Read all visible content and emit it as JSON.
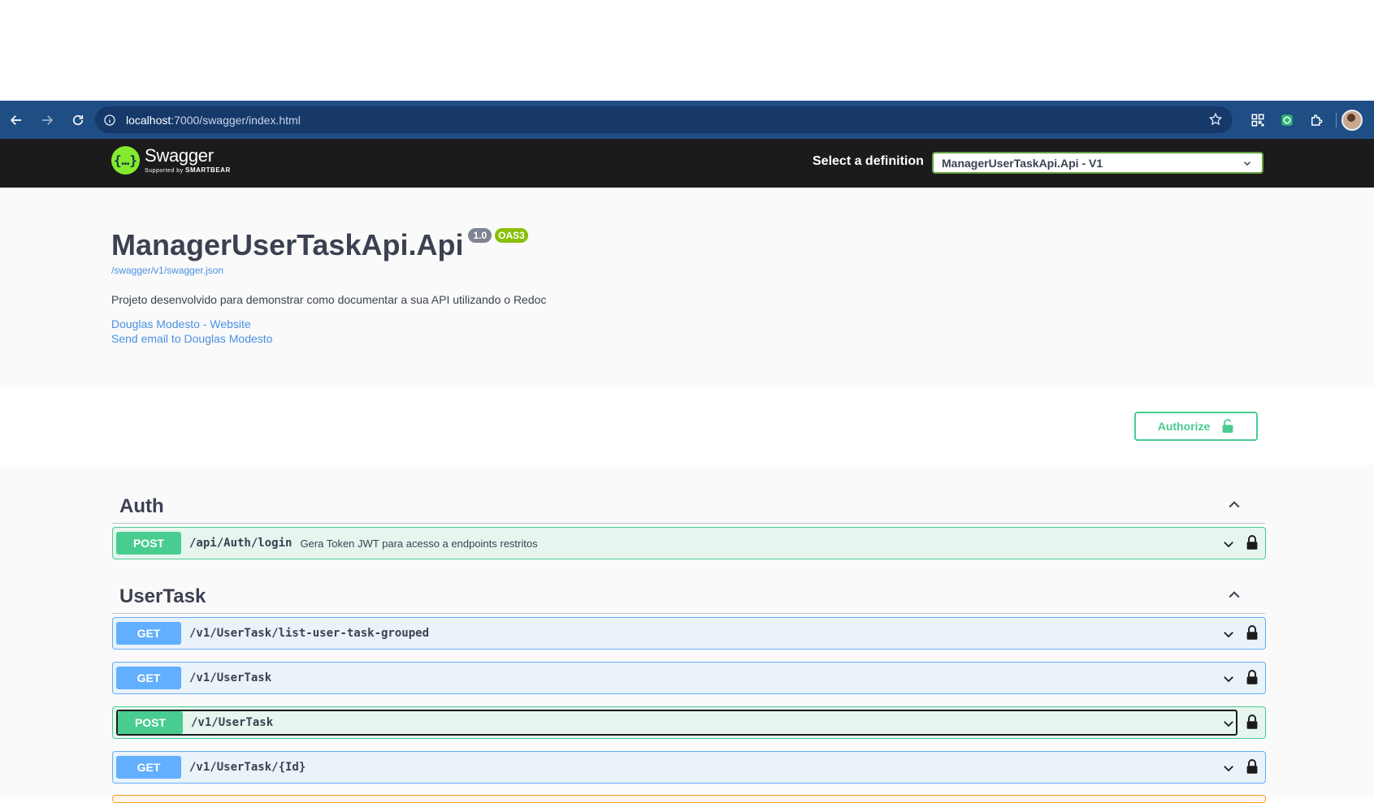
{
  "browser": {
    "url_host": "localhost",
    "url_path": ":7000/swagger/index.html"
  },
  "topbar": {
    "logo_title": "Swagger",
    "logo_supported": "Supported by",
    "logo_smartbear": "SMARTBEAR",
    "select_label": "Select a definition",
    "selected_definition": "ManagerUserTaskApi.Api - V1"
  },
  "info": {
    "title": "ManagerUserTaskApi.Api",
    "version": "1.0",
    "oas": "OAS3",
    "spec_url": "/swagger/v1/swagger.json",
    "description": "Projeto desenvolvido para demonstrar como documentar a sua API utilizando o Redoc",
    "contact_website": "Douglas Modesto - Website",
    "contact_email": "Send email to Douglas Modesto"
  },
  "authorize_label": "Authorize",
  "tags": [
    {
      "name": "Auth",
      "operations": [
        {
          "method": "POST",
          "path": "/api/Auth/login",
          "summary": "Gera Token JWT para acesso a endpoints restritos"
        }
      ]
    },
    {
      "name": "UserTask",
      "operations": [
        {
          "method": "GET",
          "path": "/v1/UserTask/list-user-task-grouped",
          "summary": ""
        },
        {
          "method": "GET",
          "path": "/v1/UserTask",
          "summary": ""
        },
        {
          "method": "POST",
          "path": "/v1/UserTask",
          "summary": ""
        },
        {
          "method": "GET",
          "path": "/v1/UserTask/{Id}",
          "summary": ""
        }
      ]
    }
  ],
  "colors": {
    "post": "#49cc90",
    "get": "#61affe",
    "topbar": "#1b1b1b",
    "browser_bar": "#1f4e84"
  }
}
